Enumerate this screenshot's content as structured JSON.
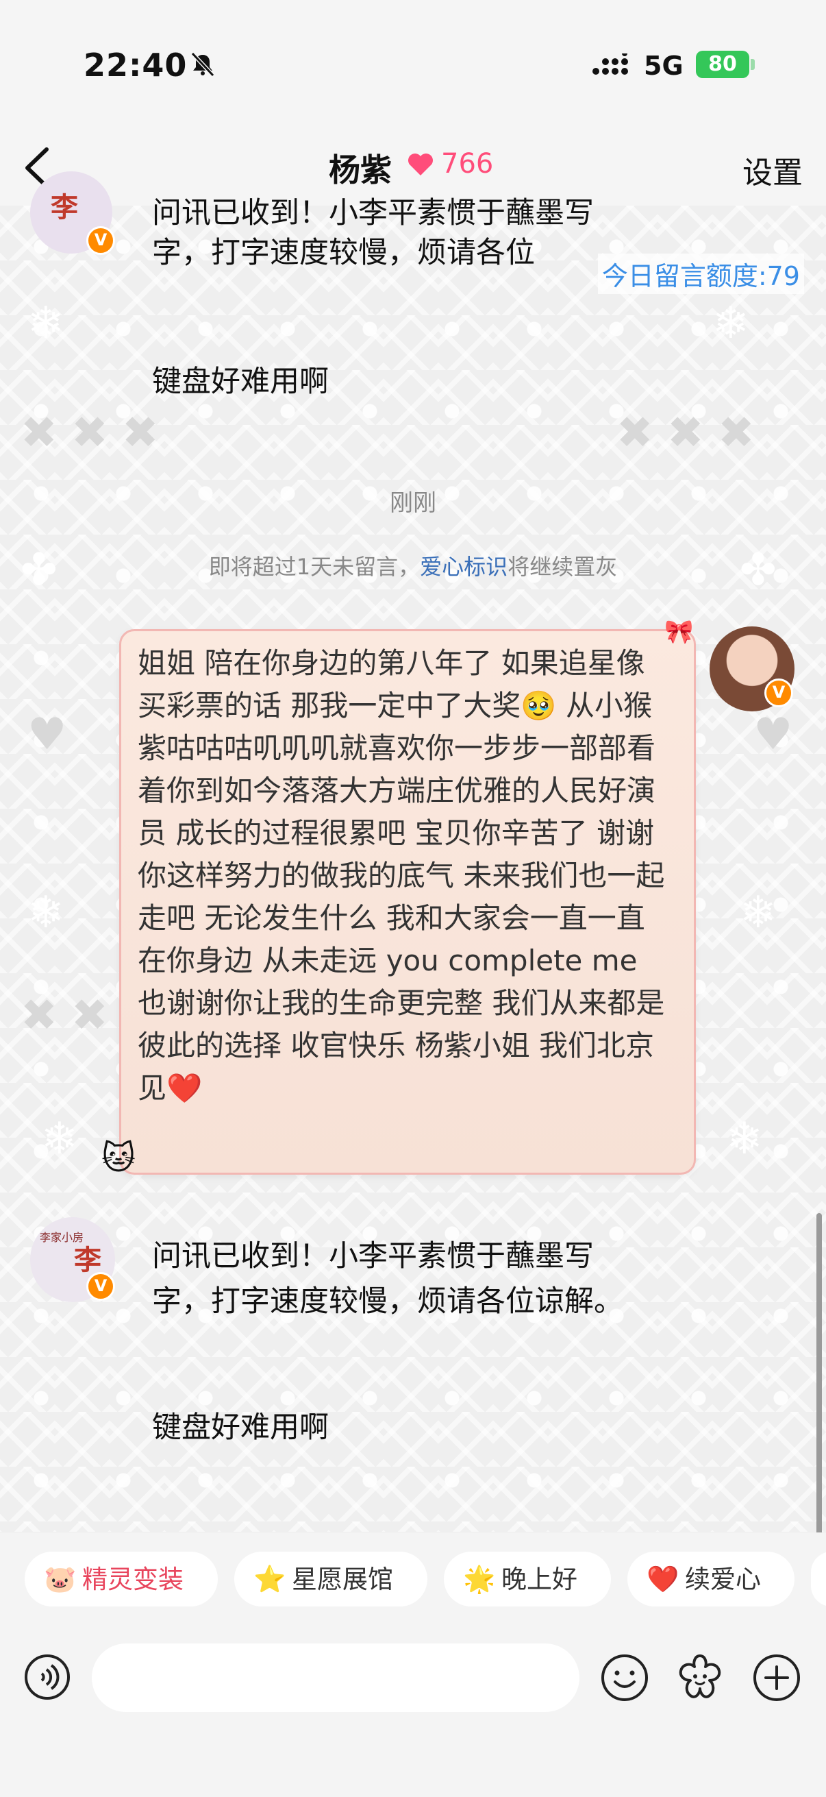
{
  "status_bar": {
    "time": "22:40",
    "network": "5G",
    "battery": "80"
  },
  "nav": {
    "title": "杨紫",
    "love_count": "766",
    "settings_label": "设置"
  },
  "quota_text": "今日留言额度:79",
  "messages": {
    "first_partial": {
      "line1": "问讯已收到！小李平素惯于蘸墨写",
      "line2": "字，打字速度较慢，烦请各位",
      "keyboard": "键盘好难用啊"
    },
    "system_time": "刚刚",
    "system_note": {
      "prefix": "即将超过1天未留言，",
      "link": "爱心标识",
      "suffix": "将继续置灰"
    },
    "my_message": "姐姐 陪在你身边的第八年了 如果追星像买彩票的话 那我一定中了大奖🥹 从小猴紫咕咕咕叽叽叽就喜欢你一步步一部部看着你到如今落落大方端庄优雅的人民好演员 成长的过程很累吧 宝贝你辛苦了 谢谢你这样努力的做我的底气 未来我们也一起走吧 无论发生什么 我和大家会一直一直在你身边 从未走远 you complete me 也谢谢你让我的生命更完整 我们从来都是彼此的选择 收官快乐 杨紫小姐 我们北京见❤️",
    "reply": {
      "line1": "问讯已收到！小李平素惯于蘸墨写",
      "line2": "字，打字速度较慢，烦请各位谅解。",
      "keyboard": "键盘好难用啊"
    }
  },
  "avatar_text": {
    "brand": "李家小房",
    "name": "李",
    "badge": "V"
  },
  "chips": [
    {
      "label": "精灵变装",
      "icon": "🐷",
      "color": "#e8455d"
    },
    {
      "label": "星愿展馆",
      "icon": "⭐",
      "color": "#333333"
    },
    {
      "label": "晚上好",
      "icon": "🌟",
      "color": "#333333"
    },
    {
      "label": "续爱心",
      "icon": "❤️",
      "color": "#333333"
    }
  ],
  "colors": {
    "accent_pink": "#ff4d7a",
    "link_blue": "#3a8ee6",
    "badge_orange": "#ff8a00"
  }
}
